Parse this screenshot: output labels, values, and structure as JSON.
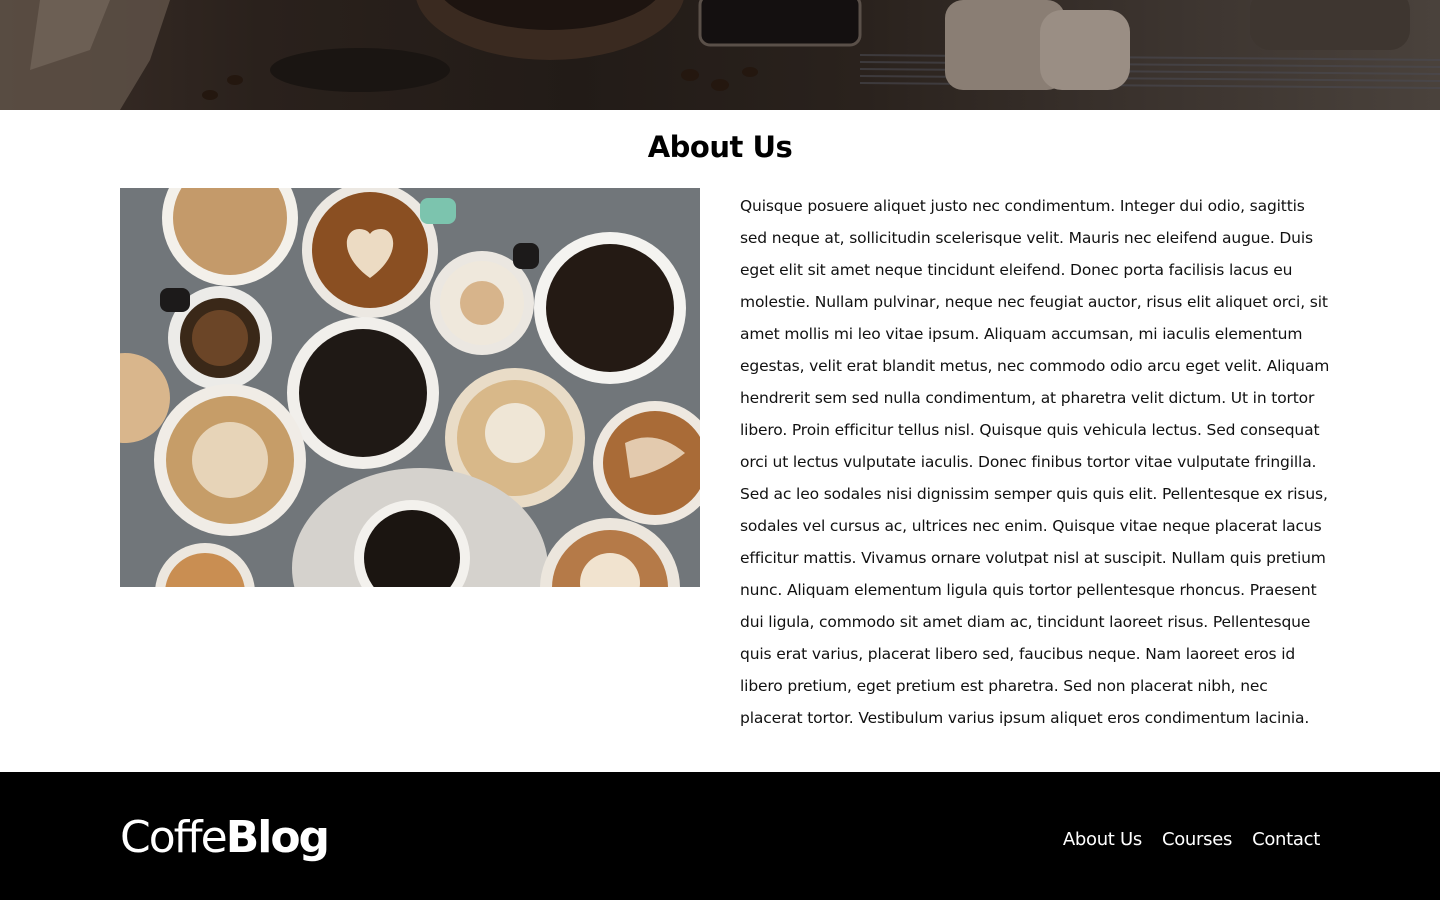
{
  "about": {
    "title": "About Us",
    "paragraph": "Quisque posuere aliquet justo nec condimentum. Integer dui odio, sagittis sed neque at, sollicitudin scelerisque velit. Mauris nec eleifend augue. Duis eget elit sit amet neque tincidunt eleifend. Donec porta facilisis lacus eu molestie. Nullam pulvinar, neque nec feugiat auctor, risus elit aliquet orci, sit amet mollis mi leo vitae ipsum. Aliquam accumsan, mi iaculis elementum egestas, velit erat blandit metus, nec commodo odio arcu eget velit. Aliquam hendrerit sem sed nulla condimentum, at pharetra velit dictum. Ut in tortor libero. Proin efficitur tellus nisl. Quisque quis vehicula lectus. Sed consequat orci ut lectus vulputate iaculis. Donec finibus tortor vitae vulputate fringilla. Sed ac leo sodales nisi dignissim semper quis quis elit. Pellentesque ex risus, sodales vel cursus ac, ultrices nec enim. Quisque vitae neque placerat lacus efficitur mattis. Vivamus ornare volutpat nisl at suscipit. Nullam quis pretium nunc. Aliquam elementum ligula quis tortor pellentesque rhoncus. Praesent dui ligula, commodo sit amet diam ac, tincidunt laoreet risus. Pellentesque quis erat varius, placerat libero sed, faucibus neque. Nam laoreet eros id libero pretium, eget pretium est pharetra. Sed non placerat nibh, nec placerat tortor. Vestibulum varius ipsum aliquet eros condimentum lacinia."
  },
  "footer": {
    "logo_light": "Coffe",
    "logo_bold": "Blog",
    "nav": [
      {
        "label": "About Us"
      },
      {
        "label": "Courses"
      },
      {
        "label": "Contact"
      }
    ]
  },
  "colors": {
    "footer_bg": "#000000",
    "text": "#111111"
  }
}
